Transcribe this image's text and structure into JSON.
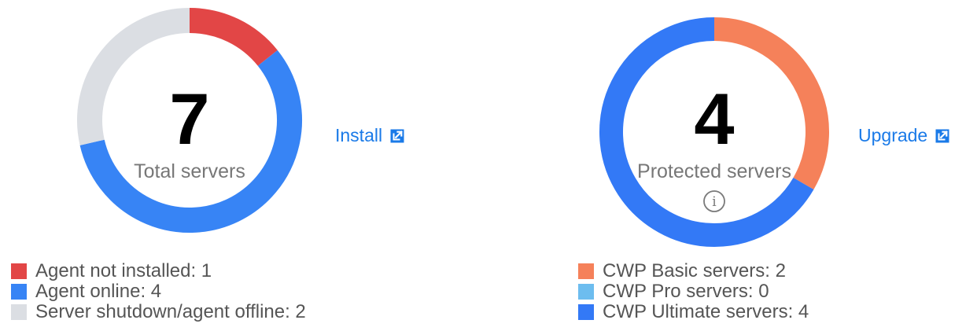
{
  "chart_data": [
    {
      "type": "pie",
      "style": "donut",
      "center_value": "7",
      "center_label": "Total servers",
      "action_label": "Install",
      "action_icon": "external-link-icon",
      "start_angle_deg": 0,
      "slices": [
        {
          "label": "Agent not installed",
          "value": 1,
          "legend": "Agent not installed: 1",
          "color": "#e24646"
        },
        {
          "label": "Agent online",
          "value": 4,
          "legend": "Agent online: 4",
          "color": "#3784f5"
        },
        {
          "label": "Server shutdown/agent offline",
          "value": 2,
          "legend": "Server shutdown/agent offline: 2",
          "color": "#dbdee3"
        }
      ]
    },
    {
      "type": "pie",
      "style": "donut",
      "center_value": "4",
      "center_label": "Protected servers",
      "center_icon": "info-icon",
      "action_label": "Upgrade",
      "action_icon": "external-link-icon",
      "start_angle_deg": 0,
      "slices": [
        {
          "label": "CWP Basic servers",
          "value": 2,
          "legend": "CWP Basic servers: 2",
          "color": "#f5815a"
        },
        {
          "label": "CWP Pro servers",
          "value": 0,
          "legend": "CWP Pro servers: 0",
          "color": "#6dbdef"
        },
        {
          "label": "CWP Ultimate servers",
          "value": 4,
          "legend": "CWP Ultimate servers: 4",
          "color": "#3379f6"
        }
      ]
    }
  ],
  "colors": {
    "link": "#1a7ae8",
    "center_number": "#000000",
    "center_label": "#777777",
    "legend_text": "#555555"
  }
}
